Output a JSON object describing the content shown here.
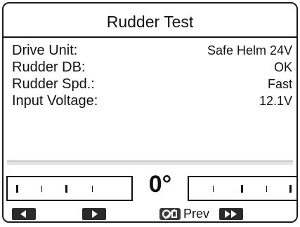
{
  "screen": {
    "title": "Rudder Test",
    "rows": [
      {
        "label": "Drive Unit:",
        "value": "Safe Helm 24V"
      },
      {
        "label": "Rudder DB:",
        "value": "OK"
      },
      {
        "label": "Rudder Spd.:",
        "value": "Fast"
      },
      {
        "label": "Input Voltage:",
        "value": "12.1V"
      }
    ]
  },
  "rudder": {
    "angle_display": "0°"
  },
  "softkeys": {
    "prev_label": "Prev",
    "icons": [
      "arrow-left-icon",
      "arrow-right-icon",
      "on-off-icon",
      "fast-forward-icon"
    ]
  },
  "colors": {
    "foreground": "#111111",
    "background": "#ffffff",
    "softkey": "#2a2a2a"
  }
}
